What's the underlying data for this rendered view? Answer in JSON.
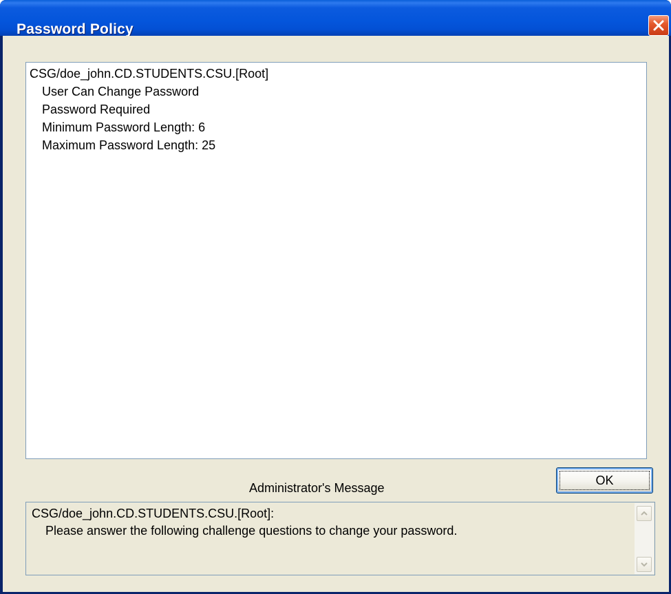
{
  "window": {
    "title": "Password Policy",
    "close_icon": "close-x-icon"
  },
  "policy": {
    "context": "CSG/doe_john.CD.STUDENTS.CSU.[Root]",
    "rules": [
      "User Can Change Password",
      "Password Required",
      "Minimum Password Length: 6",
      "Maximum Password Length: 25"
    ]
  },
  "admin_message": {
    "label": "Administrator's Message",
    "lines": [
      "CSG/doe_john.CD.STUDENTS.CSU.[Root]:",
      "Please answer the following challenge questions to change your password."
    ]
  },
  "buttons": {
    "ok_label": "OK"
  },
  "colors": {
    "titlebar": "#0455db",
    "dialog_face": "#ece9d8",
    "field_border": "#7f9db9",
    "close_button": "#e55a2e"
  }
}
